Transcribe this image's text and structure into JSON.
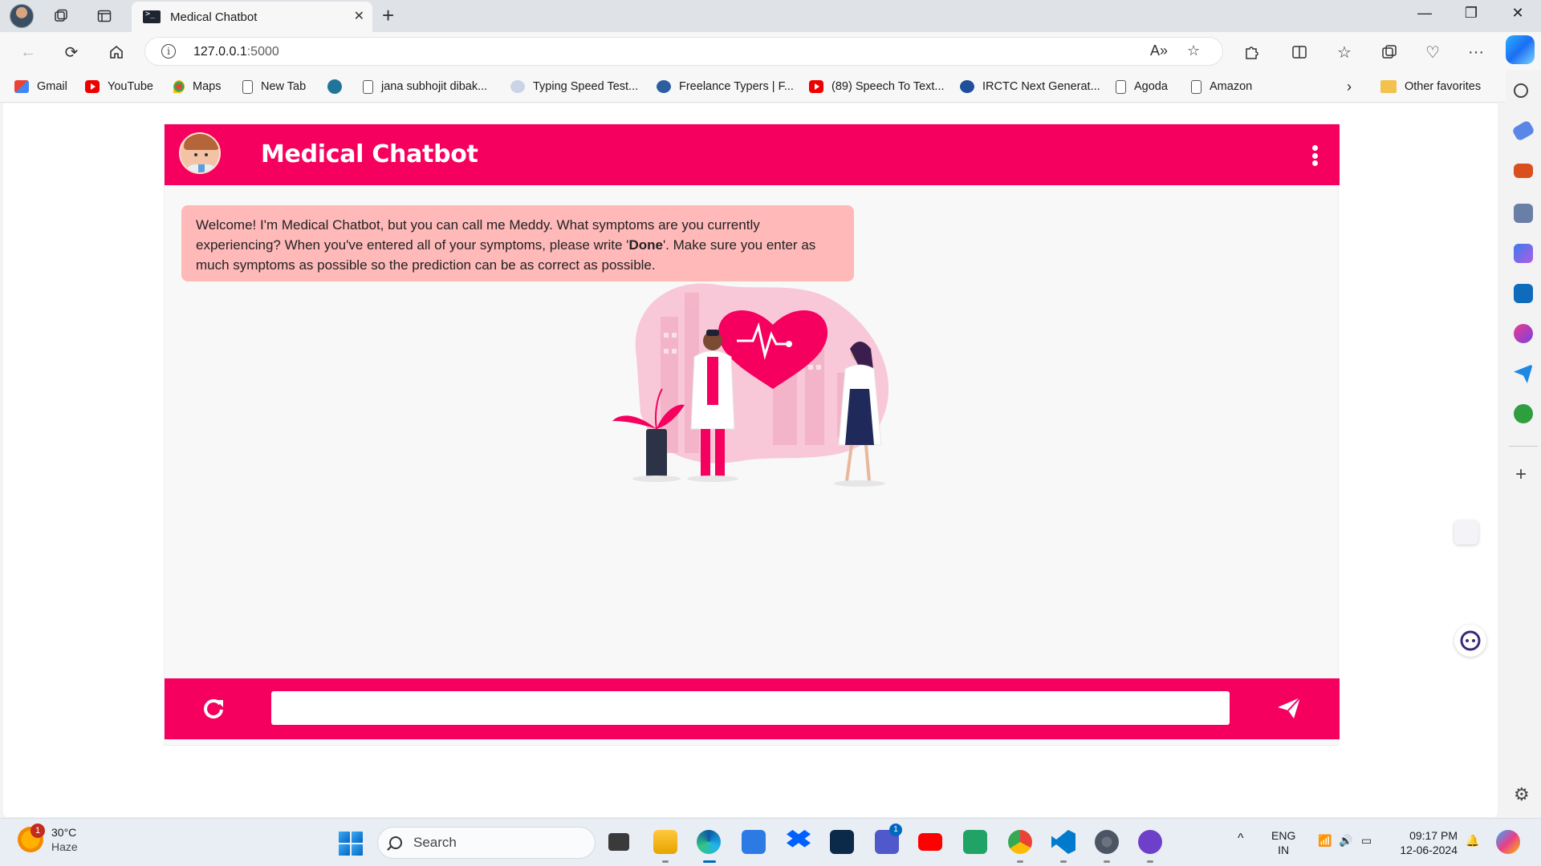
{
  "browser": {
    "tab_title": "Medical Chatbot",
    "url_host": "127.0.0.1",
    "url_port": ":5000",
    "bookmarks": [
      {
        "label": "Gmail",
        "icon": "gmail-icon"
      },
      {
        "label": "YouTube",
        "icon": "youtube-icon"
      },
      {
        "label": "Maps",
        "icon": "maps-icon"
      },
      {
        "label": "New Tab",
        "icon": "page-icon"
      },
      {
        "label": "",
        "icon": "wordpress-icon"
      },
      {
        "label": "jana subhojit dibak...",
        "icon": "page-icon"
      },
      {
        "label": "Typing Speed Test...",
        "icon": "typing-icon"
      },
      {
        "label": "Freelance Typers | F...",
        "icon": "freelance-icon"
      },
      {
        "label": "(89) Speech To Text...",
        "icon": "youtube-icon"
      },
      {
        "label": "IRCTC Next Generat...",
        "icon": "irctc-icon"
      },
      {
        "label": "Agoda",
        "icon": "page-icon"
      },
      {
        "label": "Amazon",
        "icon": "page-icon"
      }
    ],
    "other_favorites": "Other favorites"
  },
  "chat": {
    "title": "Medical Chatbot",
    "welcome_part1": "Welcome! I'm Medical Chatbot, but you can call me Meddy. What symptoms are you currently experiencing? When you've entered all of your symptoms, please write '",
    "welcome_bold": "Done",
    "welcome_part2": "'. Make sure you enter as much symptoms as possible so the prediction can be as correct as possible.",
    "input_value": "",
    "input_placeholder": ""
  },
  "taskbar": {
    "weather_badge": "1",
    "temperature": "30°C",
    "condition": "Haze",
    "search_label": "Search",
    "teams_badge": "1",
    "language": "ENG",
    "region": "IN",
    "time": "09:17 PM",
    "date": "12-06-2024"
  },
  "colors": {
    "brand": "#f5005e",
    "bubble": "#ffb9b9"
  }
}
